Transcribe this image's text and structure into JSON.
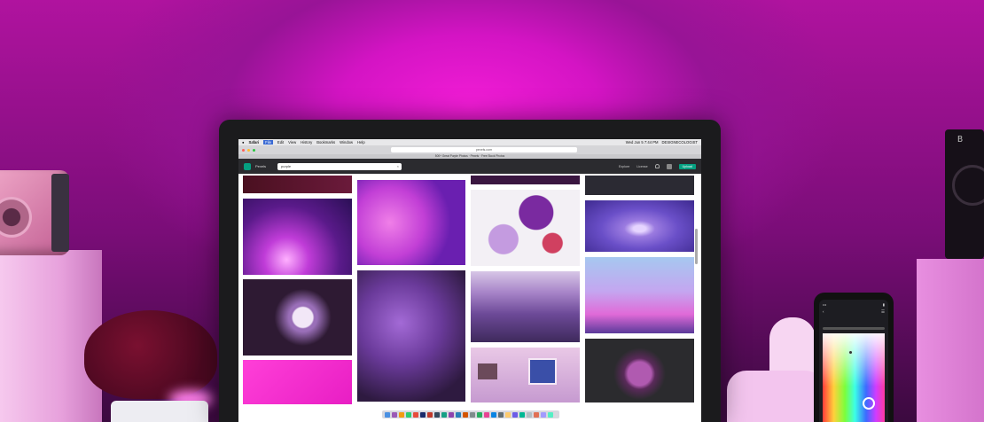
{
  "browser": {
    "menu_items": [
      "Safari",
      "File",
      "Edit",
      "View",
      "History",
      "Bookmarks",
      "Window",
      "Help"
    ],
    "status_right": "Wed Jun 5 7:44 PM",
    "user_name": "DESIGNECOLOGIST",
    "url": "pexels.com",
    "tab_title": "500+ Great Purple Photos · Pexels · Free Stock Photos"
  },
  "site": {
    "brand": "Pexels",
    "search_value": "purple",
    "nav": {
      "explore": "Explore",
      "license": "License",
      "upload": "Upload"
    }
  },
  "speaker": {
    "label": "B"
  },
  "colors": {
    "accent": "#05a081",
    "wall_glow": "#f21cd6"
  },
  "icons": [
    "apple-icon",
    "bell-icon",
    "close-icon",
    "search-icon"
  ]
}
